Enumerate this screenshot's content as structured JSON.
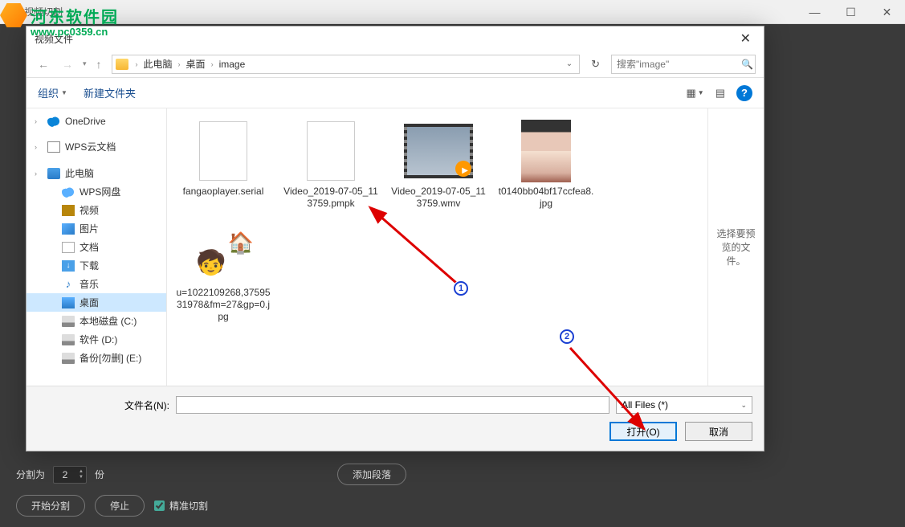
{
  "main": {
    "title": "视频切割",
    "win_min": "—",
    "win_max": "☐",
    "win_close": "✕"
  },
  "bottom": {
    "split_label": "分割为",
    "split_value": "2",
    "unit": "份",
    "add_segment": "添加段落",
    "start": "开始分割",
    "stop": "停止",
    "precise": "精准切割"
  },
  "dialog": {
    "title": "视频文件",
    "close": "✕",
    "nav_back": "←",
    "nav_fwd": "→",
    "nav_up": "↑",
    "breadcrumb": [
      "此电脑",
      "桌面",
      "image"
    ],
    "refresh": "↻",
    "search_placeholder": "搜索\"image\"",
    "toolbar_organize": "组织",
    "toolbar_newfolder": "新建文件夹",
    "view_icons": "▦",
    "view_list": "▤",
    "help": "?",
    "filename_label": "文件名(N):",
    "filename_value": "",
    "filetype": "All Files (*)",
    "open_btn": "打开(O)",
    "cancel_btn": "取消",
    "preview_hint": "选择要预览的文件。"
  },
  "sidebar": {
    "items": [
      {
        "label": "OneDrive",
        "icon": "ic-cloud"
      },
      {
        "label": "WPS云文档",
        "icon": "ic-doc"
      },
      {
        "label": "此电脑",
        "icon": "ic-pc"
      },
      {
        "label": "WPS网盘",
        "icon": "ic-wps",
        "indent": true
      },
      {
        "label": "视频",
        "icon": "ic-video",
        "indent": true
      },
      {
        "label": "图片",
        "icon": "ic-pic",
        "indent": true
      },
      {
        "label": "文档",
        "icon": "ic-docf",
        "indent": true
      },
      {
        "label": "下载",
        "icon": "ic-dl",
        "indent": true
      },
      {
        "label": "音乐",
        "icon": "ic-music",
        "indent": true,
        "glyph": "♪"
      },
      {
        "label": "桌面",
        "icon": "ic-desktop",
        "indent": true,
        "selected": true
      },
      {
        "label": "本地磁盘 (C:)",
        "icon": "ic-disk",
        "indent": true
      },
      {
        "label": "软件 (D:)",
        "icon": "ic-disk",
        "indent": true
      },
      {
        "label": "备份[勿删] (E:)",
        "icon": "ic-disk",
        "indent": true
      }
    ]
  },
  "files": [
    {
      "label": "fangaoplayer.serial",
      "thumb": "blank"
    },
    {
      "label": "Video_2019-07-05_113759.pmpk",
      "thumb": "blank"
    },
    {
      "label": "Video_2019-07-05_113759.wmv",
      "thumb": "video"
    },
    {
      "label": "t0140bb04bf17ccfea8.jpg",
      "thumb": "photo"
    },
    {
      "label": "u=1022109268,3759531978&fm=27&gp=0.jpg",
      "thumb": "illus"
    }
  ],
  "markers": {
    "m1": "1",
    "m2": "2"
  },
  "watermark": {
    "line1": "河东软件园",
    "line2": "www.pc0359.cn"
  }
}
